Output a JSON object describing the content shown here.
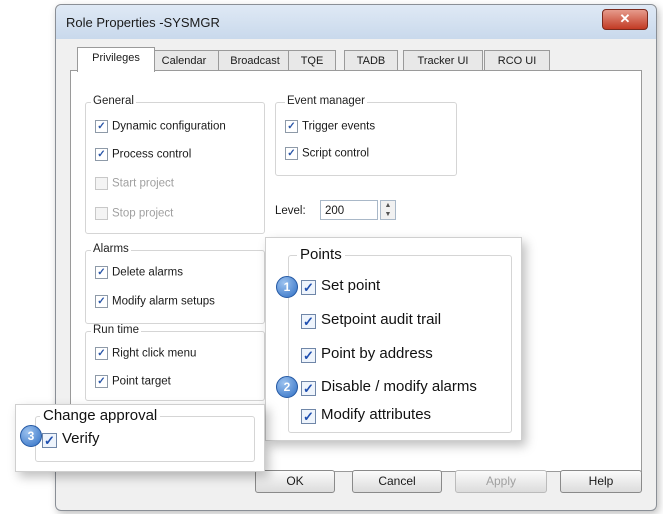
{
  "window": {
    "title": "Role Properties -SYSMGR",
    "close_glyph": "✕"
  },
  "tabs": [
    {
      "label": "Privileges",
      "active": true
    },
    {
      "label": "Calendar"
    },
    {
      "label": "Broadcast"
    },
    {
      "label": "TQE"
    },
    {
      "label": "TADB"
    },
    {
      "label": "Tracker UI"
    },
    {
      "label": "RCO UI"
    }
  ],
  "general": {
    "label": "General",
    "items": [
      {
        "label": "Dynamic configuration",
        "checked": true
      },
      {
        "label": "Process control",
        "checked": true
      },
      {
        "label": "Start project",
        "checked": false,
        "disabled": true
      },
      {
        "label": "Stop project",
        "checked": false,
        "disabled": true
      }
    ]
  },
  "event_manager": {
    "label": "Event manager",
    "items": [
      {
        "label": "Trigger events",
        "checked": true
      },
      {
        "label": "Script control",
        "checked": true
      }
    ]
  },
  "level": {
    "label": "Level:",
    "value": "200"
  },
  "alarms": {
    "label": "Alarms",
    "items": [
      {
        "label": "Delete alarms",
        "checked": true
      },
      {
        "label": "Modify alarm setups",
        "checked": true
      }
    ]
  },
  "run_time": {
    "label": "Run time",
    "items": [
      {
        "label": "Right click menu",
        "checked": true
      },
      {
        "label": "Point target",
        "checked": true
      }
    ]
  },
  "points": {
    "label": "Points",
    "items": [
      {
        "label": "Set point",
        "checked": true,
        "badge": "1"
      },
      {
        "label": "Setpoint audit trail",
        "checked": true
      },
      {
        "label": "Point by address",
        "checked": true
      },
      {
        "label": "Disable / modify alarms",
        "checked": true,
        "badge": "2"
      },
      {
        "label": "Modify attributes",
        "checked": true
      }
    ]
  },
  "change_approval": {
    "label": "Change approval",
    "items": [
      {
        "label": "Verify",
        "checked": true,
        "badge": "3"
      }
    ]
  },
  "buttons": {
    "ok": "OK",
    "cancel": "Cancel",
    "apply": "Apply",
    "help": "Help"
  },
  "icons": {
    "checkbox_checked": "check-icon",
    "close": "close-icon",
    "spinner": "spinner-icon",
    "callout_badge": "number-badge"
  }
}
